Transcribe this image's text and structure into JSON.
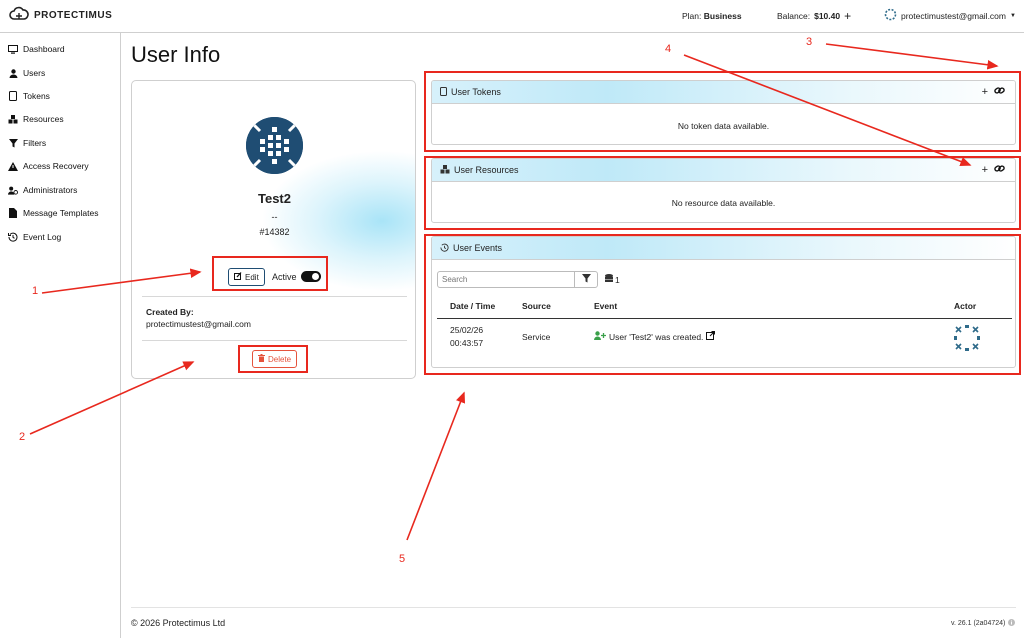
{
  "header": {
    "brand": "PROTECTIMUS",
    "plan_label": "Plan:",
    "plan_value": "Business",
    "balance_label": "Balance:",
    "balance_value": "$10.40",
    "add_balance": "+",
    "account_email": "protectimustest@gmail.com"
  },
  "sidebar": {
    "items": [
      {
        "label": "Dashboard",
        "icon": "monitor-icon"
      },
      {
        "label": "Users",
        "icon": "user-icon"
      },
      {
        "label": "Tokens",
        "icon": "tablet-icon"
      },
      {
        "label": "Resources",
        "icon": "cubes-icon"
      },
      {
        "label": "Filters",
        "icon": "filter-icon"
      },
      {
        "label": "Access Recovery",
        "icon": "warning-icon"
      },
      {
        "label": "Administrators",
        "icon": "admin-icon"
      },
      {
        "label": "Message Templates",
        "icon": "file-icon"
      },
      {
        "label": "Event Log",
        "icon": "history-icon"
      }
    ]
  },
  "page": {
    "title": "User Info"
  },
  "user_card": {
    "name": "Test2",
    "subtitle": "--",
    "id": "#14382",
    "edit_label": "Edit",
    "active_label": "Active",
    "active": true,
    "created_by_label": "Created By:",
    "created_by_value": "protectimustest@gmail.com",
    "delete_label": "Delete"
  },
  "tokens_panel": {
    "title": "User Tokens",
    "empty_text": "No token data available."
  },
  "resources_panel": {
    "title": "User Resources",
    "empty_text": "No resource data available."
  },
  "events_panel": {
    "title": "User Events",
    "search_placeholder": "Search",
    "count": "1",
    "columns": [
      "Date / Time",
      "Source",
      "Event",
      "Actor"
    ],
    "rows": [
      {
        "date": "25/02/26",
        "time": "00:43:57",
        "source": "Service",
        "event": "User 'Test2' was created."
      }
    ]
  },
  "annotations": [
    "1",
    "2",
    "3",
    "4",
    "5"
  ],
  "footer": {
    "copyright": "© 2026 Protectimus Ltd",
    "version": "v. 26.1 (2a04724)"
  },
  "colors": {
    "accent_navy": "#1f4d73",
    "annotation_red": "#e8281e",
    "delete_red": "#e5533c",
    "panel_header_blue": "#bfe9f8"
  }
}
